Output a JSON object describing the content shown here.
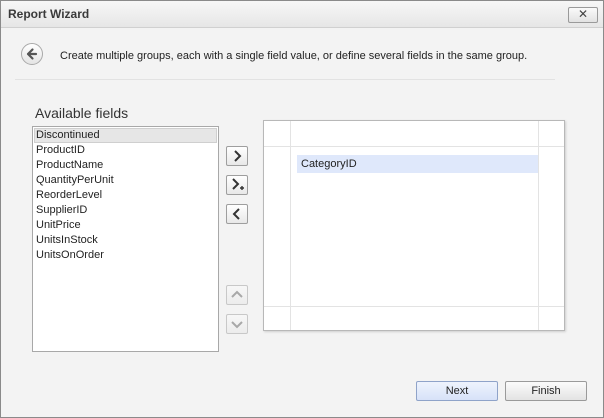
{
  "window": {
    "title": "Report Wizard",
    "close_symbol": "✕"
  },
  "instruction": "Create multiple groups, each with a single field value, or define several fields in the same group.",
  "available": {
    "title": "Available fields",
    "fields": [
      "Discontinued",
      "ProductID",
      "ProductName",
      "QuantityPerUnit",
      "ReorderLevel",
      "SupplierID",
      "UnitPrice",
      "UnitsInStock",
      "UnitsOnOrder"
    ],
    "selected_index": 0
  },
  "groups": {
    "items": [
      "CategoryID"
    ]
  },
  "buttons": {
    "next": "Next",
    "finish": "Finish"
  },
  "icons": {
    "back": "arrow-left-icon",
    "add": "chevron-right-icon",
    "add_to_group": "chevron-right-plus-icon",
    "remove": "chevron-left-icon",
    "move_up": "chevron-up-icon",
    "move_down": "chevron-down-icon"
  },
  "colors": {
    "selection": "#dfe8fb",
    "next_button": "#d7e2f8"
  }
}
